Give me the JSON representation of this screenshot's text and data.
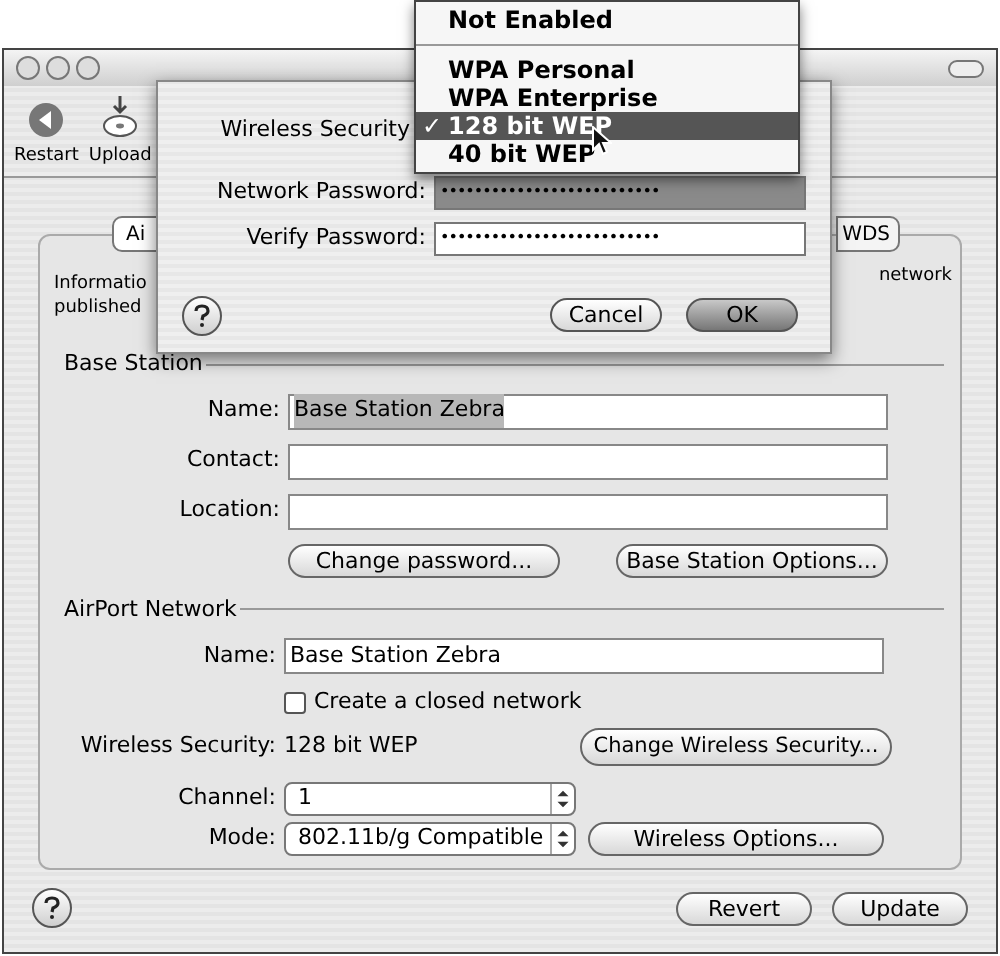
{
  "window": {
    "toolbar": [
      {
        "label": "Restart",
        "kind": "restart"
      },
      {
        "label": "Upload",
        "kind": "upload"
      }
    ],
    "tabs": [
      {
        "label": "Ai",
        "selected": true
      },
      {
        "label": "WDS",
        "selected": false
      }
    ],
    "info": [
      "Informatio",
      "published"
    ],
    "info_right": "network",
    "base_station": {
      "title": "Base Station",
      "fields": [
        {
          "label": "Name:",
          "value": "Base Station Zebra",
          "selected": true
        },
        {
          "label": "Contact:"
        },
        {
          "label": "Location:"
        }
      ],
      "buttons": [
        "Change password...",
        "Base Station Options..."
      ]
    },
    "airport_network": {
      "title": "AirPort Network",
      "name": {
        "label": "Name:",
        "value": "Base Station Zebra"
      },
      "closed_network": {
        "label": "Create a closed network",
        "checked": false
      },
      "security": {
        "label": "Wireless Security:",
        "value": "128 bit WEP",
        "button": "Change Wireless Security..."
      },
      "channel": {
        "label": "Channel:",
        "value": "1"
      },
      "mode": {
        "label": "Mode:",
        "value": "802.11b/g Compatible",
        "button": "Wireless Options..."
      }
    },
    "footer": {
      "buttons": [
        "Revert",
        "Update"
      ]
    }
  },
  "sheet": {
    "security_label": "Wireless Security",
    "network_password": {
      "label": "Network Password:",
      "value": "••••••••••••••••••••••••••",
      "selected": true
    },
    "verify_password": {
      "label": "Verify Password:",
      "value": "••••••••••••••••••••••••••",
      "selected": false
    },
    "buttons": [
      {
        "label": "Cancel",
        "default": false
      },
      {
        "label": "OK",
        "default": true
      }
    ]
  },
  "menu": {
    "items": [
      {
        "kind": "item",
        "label": "Not Enabled",
        "checked": false,
        "selected": false
      },
      {
        "kind": "separator"
      },
      {
        "kind": "item",
        "label": "WPA Personal",
        "checked": false,
        "selected": false
      },
      {
        "kind": "item",
        "label": "WPA Enterprise",
        "checked": false,
        "selected": false
      },
      {
        "kind": "item",
        "label": "128 bit WEP",
        "checked": true,
        "selected": true
      },
      {
        "kind": "item",
        "label": "40 bit WEP",
        "checked": false,
        "selected": false
      }
    ],
    "check": "✓"
  }
}
